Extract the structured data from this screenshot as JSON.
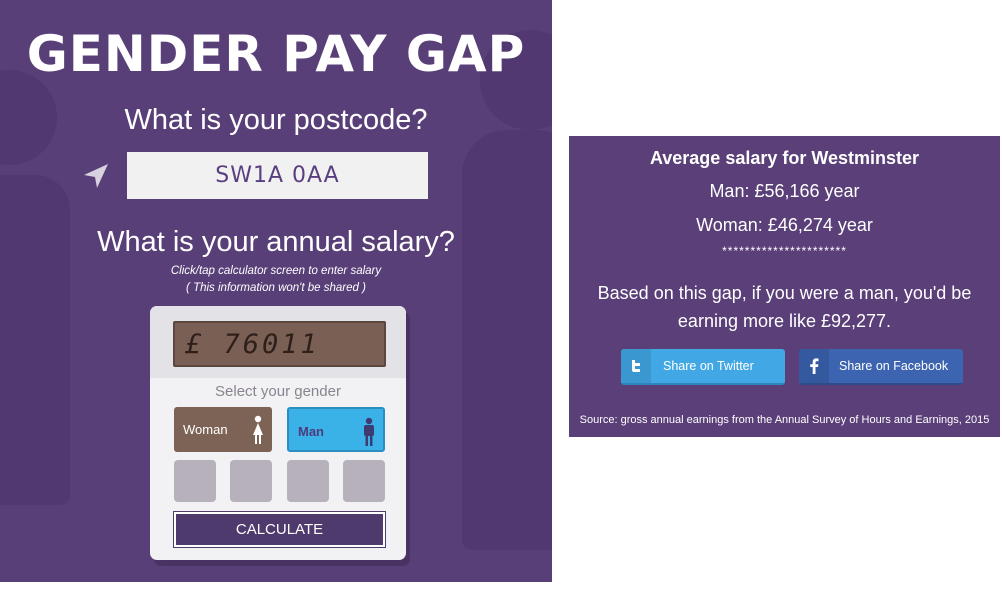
{
  "left": {
    "title": "GENDER PAY GAP",
    "postcode_question": "What is your postcode?",
    "postcode_value": "SW1A 0AA",
    "salary_question": "What is your annual salary?",
    "hint_line1": "Click/tap calculator screen to enter salary",
    "hint_line2": "( This information won't be shared )",
    "calculator": {
      "screen_value": "£ 76011",
      "gender_label": "Select your gender",
      "woman_label": "Woman",
      "man_label": "Man",
      "selected_gender": "Man",
      "calculate_label": "CALCULATE"
    }
  },
  "result": {
    "title": "Average salary for Westminster",
    "man_line": "Man: £56,166 year",
    "woman_line": "Woman: £46,274 year",
    "separator": "**********************",
    "message_line1": "Based on this gap, if you were a man, you'd be",
    "message_line2": "earning more like £92,277.",
    "share_twitter": "Share on Twitter",
    "share_facebook": "Share on Facebook",
    "source": "Source: gross annual earnings from the Annual Survey of Hours and Earnings, 2015"
  },
  "colors": {
    "panel_purple": "#593f78",
    "twitter_blue": "#41a8e5",
    "facebook_blue": "#3d64b0",
    "screen_brown": "#7a6054"
  },
  "icons": [
    "location-arrow-icon",
    "woman-icon",
    "man-icon",
    "twitter-icon",
    "facebook-icon"
  ]
}
